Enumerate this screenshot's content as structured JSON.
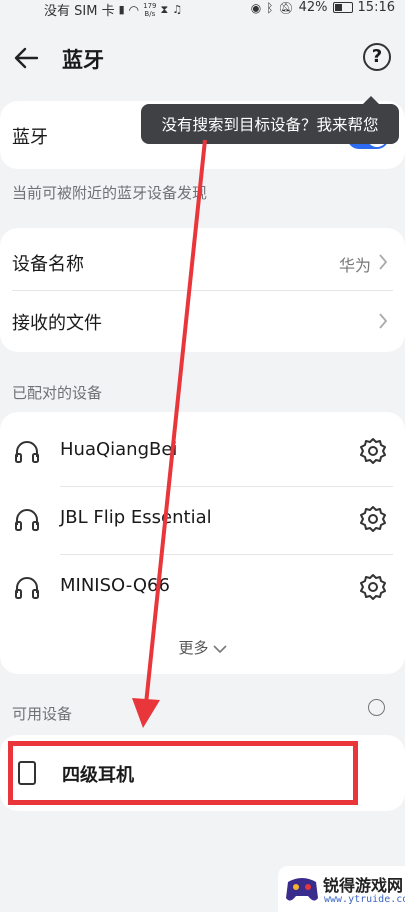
{
  "status_bar": {
    "carrier": "没有 SIM 卡",
    "speed_top": "179",
    "speed_unit": "B/s",
    "battery": "42%",
    "time": "15:16"
  },
  "header": {
    "title": "蓝牙"
  },
  "bluetooth_card": {
    "label": "蓝牙",
    "enabled": true
  },
  "tooltip": {
    "text": "没有搜索到目标设备？我来帮您"
  },
  "visibility_note": "当前可被附近的蓝牙设备发现",
  "settings": {
    "device_name_label": "设备名称",
    "device_name_value": "华为",
    "received_files_label": "接收的文件"
  },
  "paired": {
    "section_title": "已配对的设备",
    "devices": [
      {
        "name": "HuaQiangBei",
        "icon": "headphones-icon"
      },
      {
        "name": "JBL Flip Essential",
        "icon": "headphones-icon"
      },
      {
        "name": "MINISO-Q66",
        "icon": "headphones-icon"
      }
    ],
    "more_label": "更多"
  },
  "available": {
    "section_title": "可用设备",
    "devices": [
      {
        "name": "四级耳机",
        "icon": "phone-icon"
      }
    ]
  },
  "watermark": {
    "brand": "锐得游戏网",
    "url": "www.ytruide.com"
  },
  "colors": {
    "accent": "#2d6cf0",
    "annotation": "#e8363a",
    "background": "#f1f3f5"
  }
}
